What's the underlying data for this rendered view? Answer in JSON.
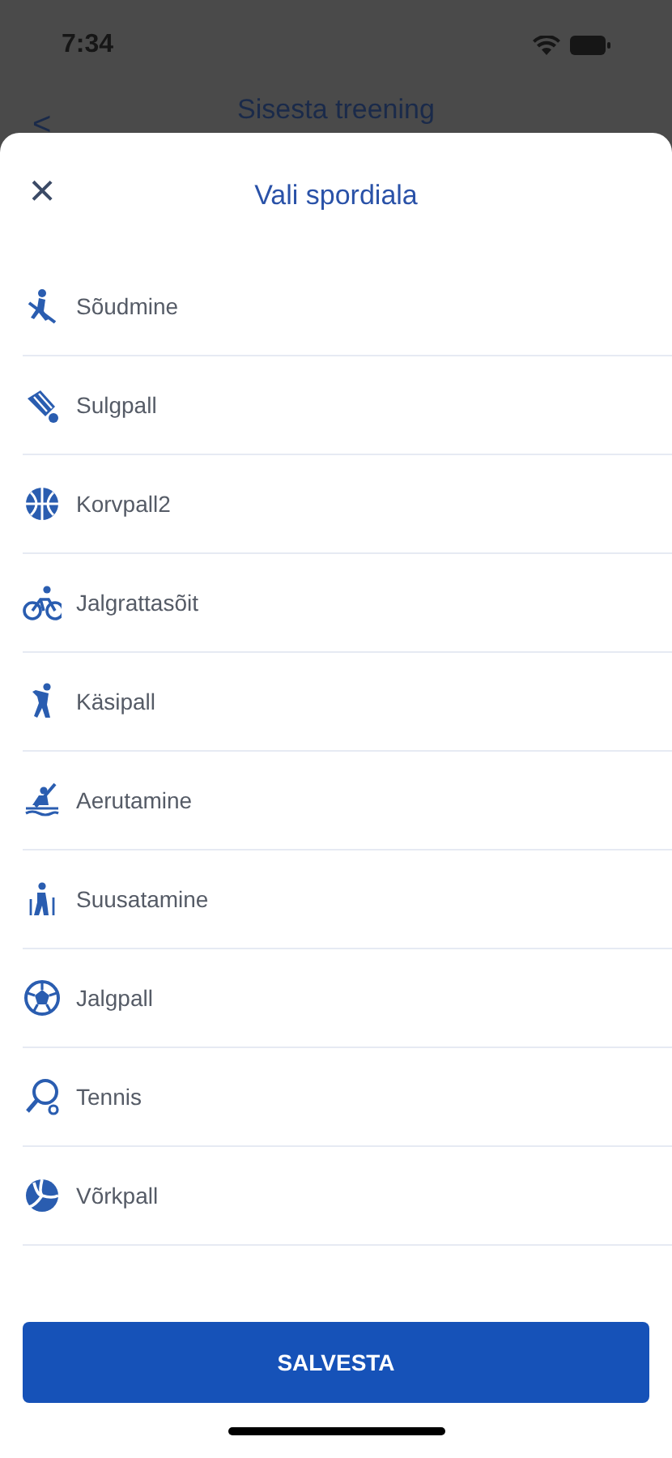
{
  "status_bar": {
    "time": "7:34"
  },
  "background_screen": {
    "back": "<",
    "title": "Sisesta treening"
  },
  "sheet": {
    "close": "×",
    "title": "Vali spordiala"
  },
  "sports": [
    {
      "label": "Sõudmine"
    },
    {
      "label": "Sulgpall"
    },
    {
      "label": "Korvpall2"
    },
    {
      "label": "Jalgrattasõit"
    },
    {
      "label": "Käsipall"
    },
    {
      "label": "Aerutamine"
    },
    {
      "label": "Suusatamine"
    },
    {
      "label": "Jalgpall"
    },
    {
      "label": "Tennis"
    },
    {
      "label": "Võrkpall"
    }
  ],
  "save_button": "SALVESTA"
}
